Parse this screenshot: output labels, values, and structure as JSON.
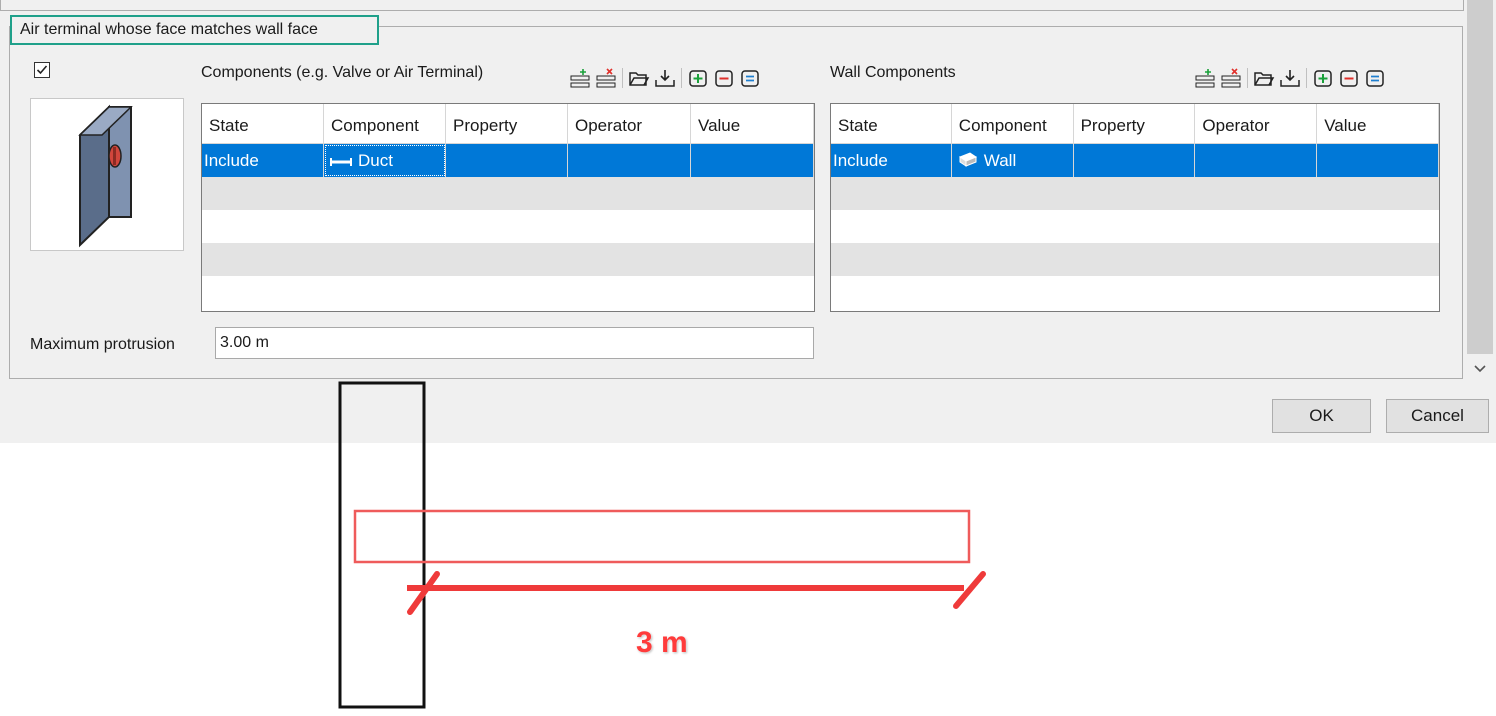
{
  "group": {
    "title": "Air terminal whose face matches wall face",
    "enabled": true
  },
  "components": {
    "label": "Components (e.g. Valve or Air Terminal)",
    "columns": [
      "State",
      "Component",
      "Property",
      "Operator",
      "Value"
    ],
    "rows": [
      {
        "state": "Include",
        "component": "Duct",
        "property": "",
        "operator": "",
        "value": ""
      }
    ]
  },
  "wall_components": {
    "label": "Wall Components",
    "columns": [
      "State",
      "Component",
      "Property",
      "Operator",
      "Value"
    ],
    "rows": [
      {
        "state": "Include",
        "component": "Wall",
        "property": "",
        "operator": "",
        "value": ""
      }
    ]
  },
  "toolbar_icons": [
    "add-row-icon",
    "delete-row-icon",
    "open-folder-icon",
    "import-icon",
    "add-group-icon",
    "remove-group-icon",
    "equals-group-icon"
  ],
  "max_protrusion": {
    "label": "Maximum protrusion",
    "value": "3.00 m"
  },
  "buttons": {
    "ok": "OK",
    "cancel": "Cancel"
  },
  "annotation": {
    "text": "3 m"
  },
  "colors": {
    "selection": "#0078d7",
    "highlight_box": "#1fa08a",
    "annotation": "#ff3b3b"
  }
}
